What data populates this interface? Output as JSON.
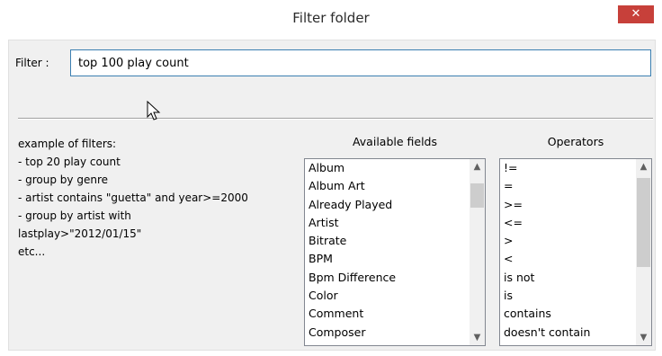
{
  "window": {
    "title": "Filter folder",
    "close_glyph": "✕"
  },
  "filter": {
    "label": "Filter :",
    "value": "top 100 play count"
  },
  "examples": {
    "lines": [
      "example of filters:",
      "- top 20 play count",
      "- group by genre",
      "- artist contains \"guetta\" and year>=2000",
      "- group by artist with",
      "lastplay>\"2012/01/15\"",
      "etc..."
    ]
  },
  "available_fields": {
    "header": "Available fields",
    "items": [
      "Album",
      "Album Art",
      "Already Played",
      "Artist",
      "Bitrate",
      "BPM",
      "Bpm Difference",
      "Color",
      "Comment",
      "Composer"
    ]
  },
  "operators": {
    "header": "Operators",
    "items": [
      "!=",
      "=",
      ">=",
      "<=",
      ">",
      "<",
      "is not",
      "is",
      "contains",
      "doesn't contain"
    ]
  },
  "icons": {
    "scroll_up": "scroll-up-arrow-icon",
    "scroll_down": "scroll-down-arrow-icon",
    "pointer": "mouse-pointer-icon"
  },
  "colors": {
    "close_button": "#c7403a",
    "input_border_focus": "#3c7fb1",
    "dialog_background": "#f0f0f0"
  }
}
